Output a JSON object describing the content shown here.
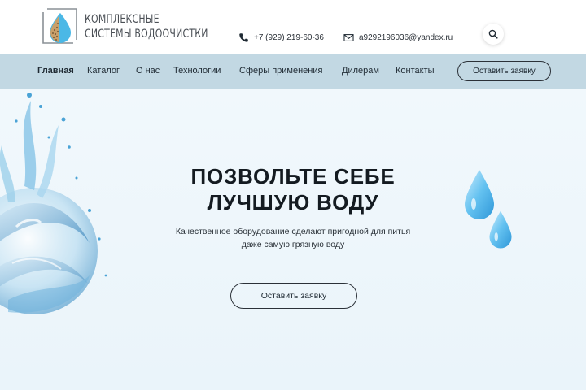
{
  "header": {
    "logo": {
      "line1": "Комплексные",
      "line2": "системы водоочистки"
    },
    "phone": "+7 (929) 219-60-36",
    "email": "a9292196036@yandex.ru",
    "phone_icon": "phone-icon",
    "email_icon": "envelope-icon",
    "search_icon": "search-icon"
  },
  "nav": {
    "items": [
      {
        "label": "Главная",
        "active": true
      },
      {
        "label": "Каталог",
        "active": false
      },
      {
        "label": "О нас",
        "active": false
      },
      {
        "label": "Технологии",
        "active": false
      },
      {
        "label": "Сферы применения",
        "active": false
      },
      {
        "label": "Дилерам",
        "active": false
      },
      {
        "label": "Контакты",
        "active": false
      }
    ],
    "cta_label": "Оставить заявку"
  },
  "hero": {
    "title_line1": "ПОЗВОЛЬТЕ СЕБЕ",
    "title_line2": "ЛУЧШУЮ ВОДУ",
    "subtitle_line1": "Качественное оборудование сделают пригодной для питья",
    "subtitle_line2": "даже самую грязную воду",
    "cta_label": "Оставить заявку"
  },
  "colors": {
    "nav_bg": "#c2d8e3",
    "hero_bg": "#eef6fb",
    "water_blue": "#5fb8e8",
    "text_dark": "#1f2a33"
  }
}
